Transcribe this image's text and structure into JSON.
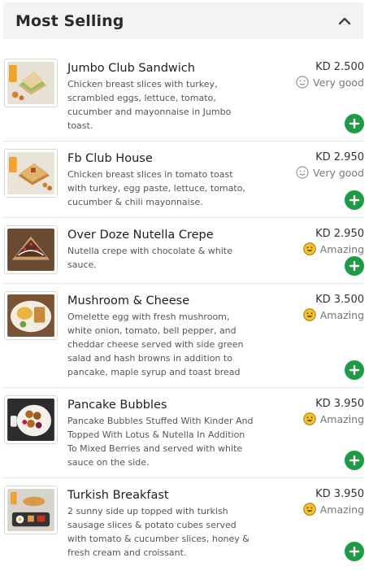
{
  "section": {
    "title": "Most Selling",
    "collapse_icon": "chevron-up-icon"
  },
  "items": [
    {
      "name": "Jumbo Club Sandwich",
      "description": "Chicken breast slices with turkey, scrambled eggs, lettuce, tomato, cucumber and mayonnaise in Jumbo toast.",
      "price": "KD 2.500",
      "rating": "Very good",
      "rating_icon": "neutral-face-icon",
      "add_icon": "plus-icon"
    },
    {
      "name": "Fb Club House",
      "description": "Chicken breast slices in tomato toast with turkey, egg paste, lettuce, tomato, cucumber & chili mayonnaise.",
      "price": "KD 2.950",
      "rating": "Very good",
      "rating_icon": "neutral-face-icon",
      "add_icon": "plus-icon"
    },
    {
      "name": "Over Doze Nutella Crepe",
      "description": "Nutella crepe with chocolate & white sauce.",
      "price": "KD 2.950",
      "rating": "Amazing",
      "rating_icon": "happy-face-icon",
      "add_icon": "plus-icon"
    },
    {
      "name": "Mushroom & Cheese",
      "description": "Omelette egg with fresh mushroom, white onion, tomato, bell pepper, and cheddar cheese served with side green salad and hash browns in addition to pancake, maple syrup and toast bread",
      "price": "KD 3.500",
      "rating": "Amazing",
      "rating_icon": "happy-face-icon",
      "add_icon": "plus-icon"
    },
    {
      "name": "Pancake Bubbles",
      "description": "Pancake Bubbles Stuffed With Kinder And Topped With Lotus & Nutella In Addition To Mixed Berries and served with white sauce on the side.",
      "price": "KD 3.950",
      "rating": "Amazing",
      "rating_icon": "happy-face-icon",
      "add_icon": "plus-icon"
    },
    {
      "name": "Turkish Breakfast",
      "description": "2 sunny side up topped with turkish sausage slices & potato cubes served with tomato & cucumber slices, honey & fresh cream and croissant.",
      "price": "KD 3.950",
      "rating": "Amazing",
      "rating_icon": "happy-face-icon",
      "add_icon": "plus-icon"
    }
  ],
  "colors": {
    "accent_green": "#1e9b44",
    "header_bg": "#f3f3f3",
    "happy_face": "#f5c224"
  }
}
